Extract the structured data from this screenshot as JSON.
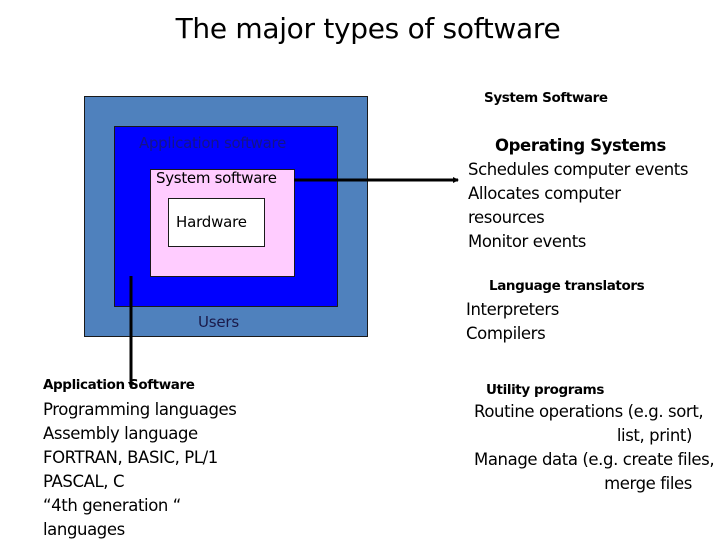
{
  "title": "The major types of software",
  "diagram": {
    "layers": {
      "users": "Users",
      "application": "Application software",
      "system": "System software",
      "hardware": "Hardware"
    },
    "colors": {
      "users_layer": "#4f81bd",
      "application_layer": "#0000ff",
      "system_layer": "#ffccff",
      "hardware_layer": "#ffffff",
      "application_label": "#14148a"
    }
  },
  "application_software": {
    "heading": "Application Software",
    "items": [
      "Programming languages",
      "Assembly language",
      "FORTRAN, BASIC, PL/1",
      "PASCAL, C",
      "“4th generation “",
      "languages"
    ]
  },
  "system_software": {
    "heading": "System Software",
    "operating_systems": {
      "heading": "Operating Systems",
      "items": [
        "Schedules computer events",
        "Allocates computer",
        "resources",
        "Monitor events"
      ]
    },
    "language_translators": {
      "heading": "Language translators",
      "items": [
        "Interpreters",
        "Compilers"
      ]
    },
    "utility_programs": {
      "heading": "Utility programs",
      "items": [
        "Routine operations (e.g. sort,",
        "list, print)",
        "Manage data (e.g. create files,",
        "merge files"
      ]
    }
  }
}
